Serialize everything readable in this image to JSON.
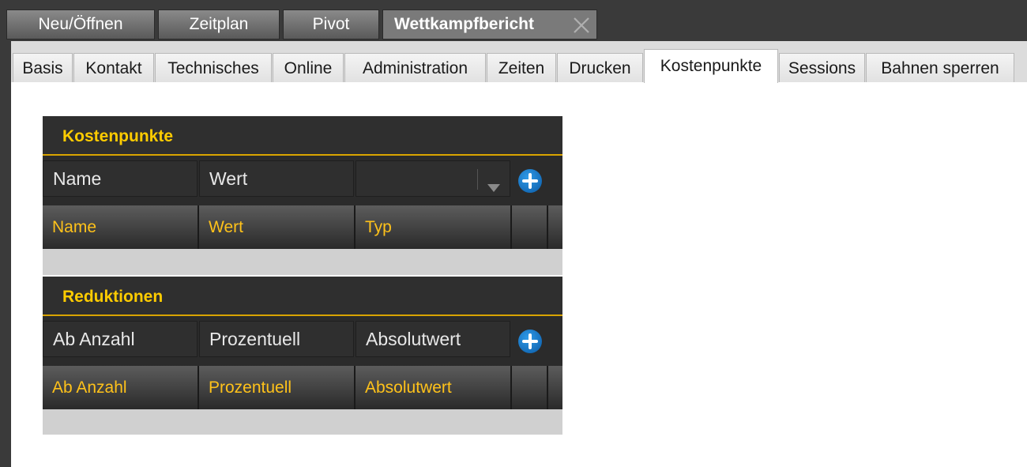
{
  "top_tabs": [
    {
      "label": "Neu/Öffnen"
    },
    {
      "label": "Zeitplan"
    },
    {
      "label": "Pivot"
    },
    {
      "label": "Wettkampfbericht",
      "active": true
    }
  ],
  "sub_tabs": [
    {
      "label": "Basis"
    },
    {
      "label": "Kontakt"
    },
    {
      "label": "Technisches"
    },
    {
      "label": "Online"
    },
    {
      "label": "Administration"
    },
    {
      "label": "Zeiten"
    },
    {
      "label": "Drucken"
    },
    {
      "label": "Kostenpunkte",
      "active": true
    },
    {
      "label": "Sessions"
    },
    {
      "label": "Bahnen sperren"
    }
  ],
  "kostenpunkte": {
    "title": "Kostenpunkte",
    "inputs": {
      "name_placeholder": "Name",
      "wert_placeholder": "Wert",
      "typ_value": ""
    },
    "columns": [
      "Name",
      "Wert",
      "Typ"
    ],
    "rows": []
  },
  "reduktionen": {
    "title": "Reduktionen",
    "inputs": {
      "ab_anzahl_placeholder": "Ab Anzahl",
      "prozentuell_placeholder": "Prozentuell",
      "absolutwert_placeholder": "Absolutwert"
    },
    "columns": [
      "Ab Anzahl",
      "Prozentuell",
      "Absolutwert"
    ],
    "rows": []
  },
  "colors": {
    "accent": "#ffcc00",
    "header_dark": "#2f2f2f",
    "add_button": "#1a7fd4"
  },
  "icons": {
    "close": "close-icon",
    "add": "plus-icon",
    "dropdown": "chevron-down-icon"
  }
}
